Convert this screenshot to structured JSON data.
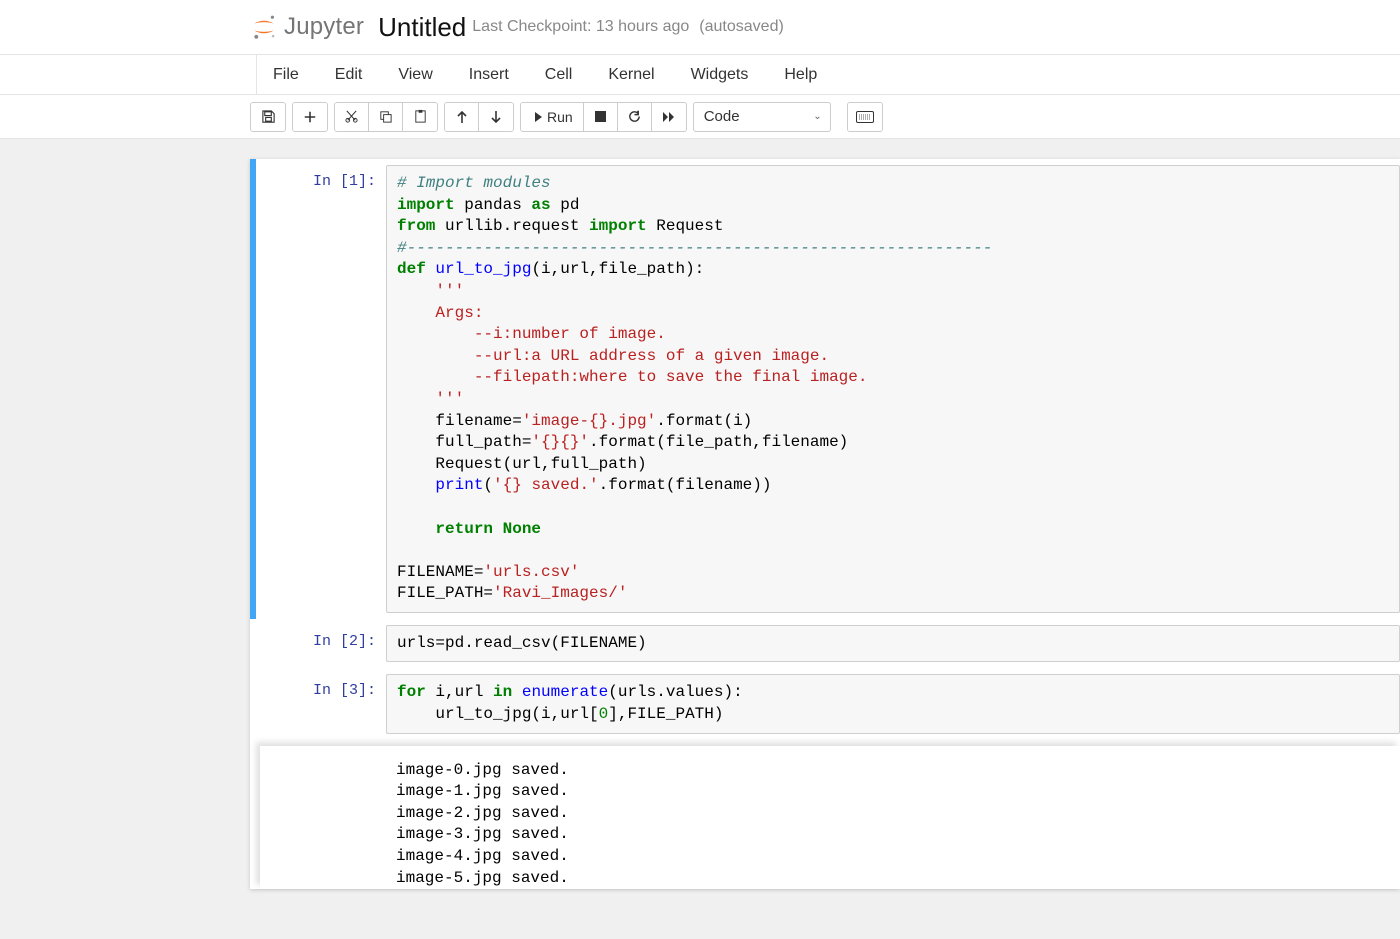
{
  "header": {
    "logo_text": "Jupyter",
    "title": "Untitled",
    "checkpoint": "Last Checkpoint: 13 hours ago",
    "autosaved": "(autosaved)"
  },
  "menu": {
    "items": [
      "File",
      "Edit",
      "View",
      "Insert",
      "Cell",
      "Kernel",
      "Widgets",
      "Help"
    ]
  },
  "toolbar": {
    "run_label": "Run",
    "cell_type": "Code"
  },
  "cells": [
    {
      "prompt": "In [1]:",
      "code_html": "<span class=\"cm\"># Import modules</span>\n<span class=\"kw\">import</span> pandas <span class=\"kw\">as</span> pd\n<span class=\"kw\">from</span> urllib.request <span class=\"kw\">import</span> Request\n<span class=\"cm\">#-------------------------------------------------------------</span>\n<span class=\"kw\">def</span> <span class=\"fn\">url_to_jpg</span>(i,url,file_path):\n    <span class=\"str\">'''</span>\n<span class=\"str\">    Args:</span>\n<span class=\"str\">        --i:number of image.</span>\n<span class=\"str\">        --url:a URL address of a given image.</span>\n<span class=\"str\">        --filepath:where to save the final image.</span>\n<span class=\"str\">    '''</span>\n    filename=<span class=\"str\">'image-{}.jpg'</span>.format(i)\n    full_path=<span class=\"str\">'{}{}'</span>.format(file_path,filename)\n    Request(url,full_path)\n    <span class=\"fn\">print</span>(<span class=\"str\">'{} saved.'</span>.format(filename))\n\n    <span class=\"kw\">return</span> <span class=\"kw\">None</span>\n\nFILENAME=<span class=\"str\">'urls.csv'</span>\nFILE_PATH=<span class=\"str\">'Ravi_Images/'</span>"
    },
    {
      "prompt": "In [2]:",
      "code_html": "urls=pd.read_csv(FILENAME)"
    },
    {
      "prompt": "In [3]:",
      "code_html": "<span class=\"kw\">for</span> i,url <span class=\"kw\">in</span> <span class=\"fn\">enumerate</span>(urls.values):\n    url_to_jpg(i,url[<span class=\"num\">0</span>],FILE_PATH)"
    }
  ],
  "output": {
    "lines": [
      "image-0.jpg saved.",
      "image-1.jpg saved.",
      "image-2.jpg saved.",
      "image-3.jpg saved.",
      "image-4.jpg saved.",
      "image-5.jpg saved."
    ]
  }
}
